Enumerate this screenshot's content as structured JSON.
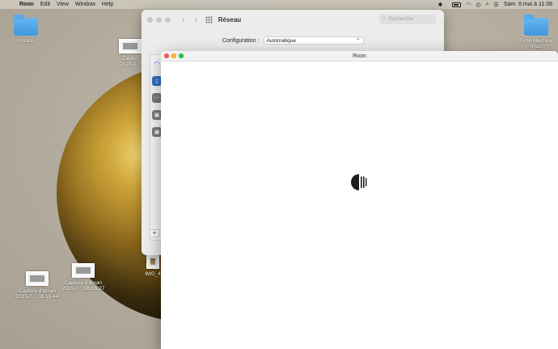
{
  "menubar": {
    "apple_icon": "apple-icon",
    "app_name": "Roon",
    "menus": [
      "Edit",
      "View",
      "Window",
      "Help"
    ],
    "status": {
      "datetime": "Sam. 6 mai à 11:08"
    }
  },
  "desktop": {
    "photos_label": "Photos",
    "time_machine_label_line1": "Time Machine",
    "time_machine_label_line2": "imac",
    "capture_top_line1": "Captur",
    "capture_top_line2": "2023-0...",
    "capture_left_line1": "Capture d'écran",
    "capture_left_line2": "2023-0....08.55.44",
    "capture_mid_line1": "Capture d'écran",
    "capture_mid_line2": "2023-0....08.55.27",
    "img_label": "IMG_4"
  },
  "reseau": {
    "title": "Réseau",
    "search_placeholder": "Rechercher",
    "config_label": "Configuration :",
    "config_value": "Automatique",
    "add_button": "+"
  },
  "roon": {
    "title": "Roon"
  },
  "colors": {
    "close": "#fe5f57",
    "minimize": "#febc2e",
    "zoom": "#28c840",
    "roon_logo": "#1e1e1e"
  }
}
